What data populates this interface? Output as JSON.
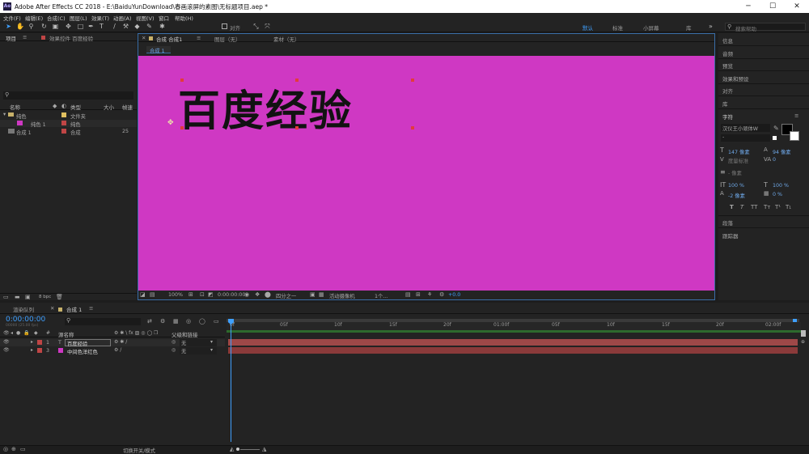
{
  "title_bar": {
    "app_title": "Adobe After Effects CC 2018 - E:\\BaiduYunDownload\\春画滚屏的素图\\无标题项目.aep *",
    "icon_label": "Ae"
  },
  "menu": [
    "文件(F)",
    "编辑(E)",
    "合成(C)",
    "图层(L)",
    "效果(T)",
    "动画(A)",
    "视图(V)",
    "窗口",
    "帮助(H)"
  ],
  "toolbar": {
    "align_label": "对齐",
    "workspaces": [
      "默认",
      "标准",
      "小屏幕",
      "库"
    ],
    "search_placeholder": "搜索帮助"
  },
  "project_panel": {
    "tabs": [
      "项目",
      "效果控件 百度经验"
    ],
    "columns": [
      "名称",
      "类型",
      "大小",
      "帧速"
    ],
    "items": [
      {
        "name": "纯色",
        "type": "文件夹",
        "size": "",
        "fps": "",
        "color": "#e0c060"
      },
      {
        "name": "纯色 1",
        "type": "纯色",
        "size": "",
        "fps": "",
        "color": "#cf38c3"
      },
      {
        "name": "合成 1",
        "type": "合成",
        "size": "",
        "fps": "25",
        "color": "#c04545"
      }
    ],
    "bpc": "8 bpc"
  },
  "comp_panel": {
    "tabs": [
      "合成 合成1",
      "图层（无）",
      "素材（无）"
    ],
    "breadcrumb": "合成 1",
    "canvas_text": "百度经验",
    "canvas_color": "#cf38c3",
    "footer": {
      "zoom": "100%",
      "time": "0:00:00:00",
      "resolution": "四分之一",
      "camera": "活动摄像机",
      "views": "1个...",
      "exposure": "+0.0"
    }
  },
  "right_panel": {
    "items": [
      "信息",
      "音频",
      "预览",
      "效果和预设",
      "对齐",
      "库"
    ],
    "character": {
      "header": "字符",
      "font": "汉仪王小顽体W",
      "style": "-",
      "size": "147 像素",
      "leading": "94 像素",
      "kerning": "度量标准",
      "tracking": "0",
      "stroke": "- 像素",
      "vscale": "100 %",
      "hscale": "100 %",
      "baseline": "-2 像素",
      "tsume": "0 %",
      "style_buttons": [
        "T",
        "T",
        "TT",
        "Tт",
        "T¹",
        "T₁"
      ]
    },
    "bottom_items": [
      "段落",
      "跟踪器"
    ]
  },
  "timeline": {
    "tabs": [
      "渲染队列",
      "合成 1"
    ],
    "timecode": "0:00:00:00",
    "timecode_sub": "00000 (25.00 fps)",
    "columns": [
      "源名称",
      "父级和链接"
    ],
    "layers": [
      {
        "index": "1",
        "type": "T",
        "name": "百度经验",
        "parent": "无",
        "color": "#c04545"
      },
      {
        "index": "3",
        "type": "",
        "name": "中间色洋红色",
        "parent": "无",
        "color": "#cf38c3"
      }
    ],
    "ruler": [
      "0f",
      "05f",
      "10f",
      "15f",
      "20f",
      "01:00f",
      "05f",
      "10f",
      "15f",
      "20f",
      "02:00f"
    ],
    "footer_label": "切换开关/模式"
  }
}
